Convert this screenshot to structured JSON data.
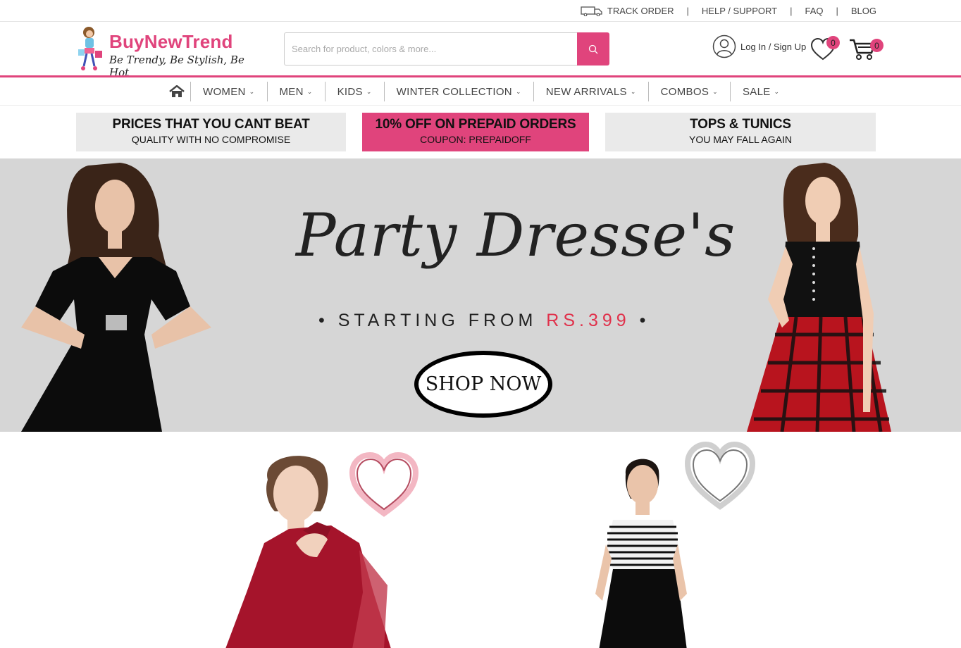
{
  "topbar": {
    "links": [
      "TRACK ORDER",
      "HELP / SUPPORT",
      "FAQ",
      "BLOG"
    ],
    "separator": "|"
  },
  "brand": {
    "name": "BuyNewTrend",
    "tagline": "Be Trendy, Be Stylish, Be Hot",
    "color": "#e0447c"
  },
  "search": {
    "placeholder": "Search for product, colors & more...",
    "value": ""
  },
  "account": {
    "label": "Log In / Sign Up"
  },
  "wishlist": {
    "count": "0"
  },
  "cart": {
    "count": "0"
  },
  "nav": {
    "items": [
      "WOMEN",
      "MEN",
      "KIDS",
      "WINTER COLLECTION",
      "NEW ARRIVALS",
      "COMBOS",
      "SALE"
    ]
  },
  "promos": [
    {
      "heading": "PRICES THAT YOU CANT BEAT",
      "sub": "QUALITY WITH NO COMPROMISE"
    },
    {
      "heading": "10% OFF ON PREPAID ORDERS",
      "sub": "COUPON: PREPAIDOFF"
    },
    {
      "heading": "TOPS & TUNICS",
      "sub": "YOU MAY FALL AGAIN"
    }
  ],
  "hero": {
    "title": "Party Dresse's",
    "sub_prefix": "STARTING FROM",
    "sub_price": "RS.399",
    "cta": "SHOP NOW"
  }
}
